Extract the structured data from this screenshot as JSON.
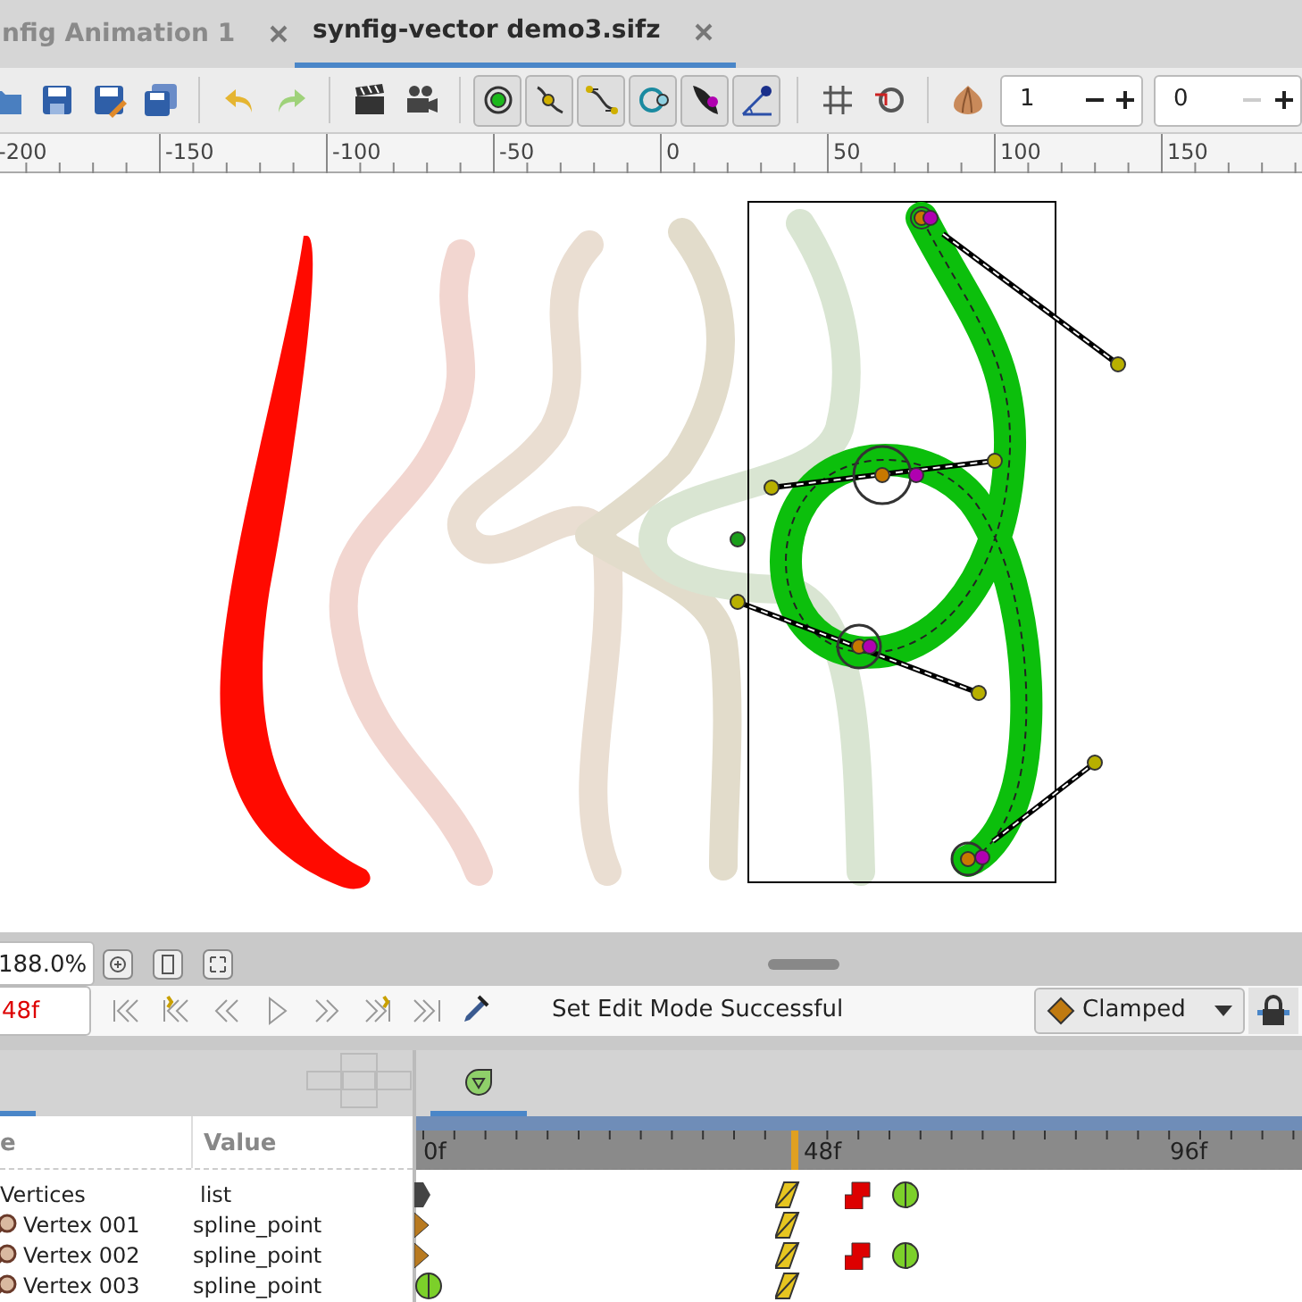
{
  "tabs": [
    {
      "label": "nfig Animation 1",
      "selected": false
    },
    {
      "label": "synfig-vector demo3.sifz",
      "selected": true
    }
  ],
  "toolbar": {
    "spin_fields": [
      {
        "value": "1",
        "minus_disabled": false
      },
      {
        "value": "0",
        "minus_disabled": true
      }
    ]
  },
  "ruler": {
    "labels": [
      "-200",
      "-150",
      "-100",
      "-50",
      "0",
      "50",
      "100",
      "150"
    ]
  },
  "zoom": {
    "value": "188.0%"
  },
  "frame": {
    "value": "48f"
  },
  "status": "Set Edit Mode Successful",
  "interpolation": {
    "value": "Clamped"
  },
  "params": {
    "columns": [
      "e",
      "Value"
    ],
    "rows": [
      {
        "name": "Vertices",
        "value": "list",
        "kind": "list"
      },
      {
        "name": "Vertex 001",
        "value": "spline_point",
        "kind": "vertex"
      },
      {
        "name": "Vertex 002",
        "value": "spline_point",
        "kind": "vertex"
      },
      {
        "name": "Vertex 003",
        "value": "spline_point",
        "kind": "vertex"
      }
    ]
  },
  "timetrack": {
    "time_labels": [
      "0f",
      "48f",
      "96f"
    ],
    "rows": [
      {
        "waypoints": [
          {
            "kind": "start"
          },
          {
            "kind": "linear"
          },
          {
            "kind": "constant"
          },
          {
            "kind": "smooth"
          }
        ]
      },
      {
        "waypoints": [
          {
            "kind": "clamped"
          },
          {
            "kind": "linear"
          }
        ]
      },
      {
        "waypoints": [
          {
            "kind": "clamped"
          },
          {
            "kind": "linear"
          },
          {
            "kind": "constant"
          },
          {
            "kind": "smooth"
          }
        ]
      },
      {
        "waypoints": [
          {
            "kind": "smooth"
          },
          {
            "kind": "linear"
          }
        ]
      }
    ]
  }
}
